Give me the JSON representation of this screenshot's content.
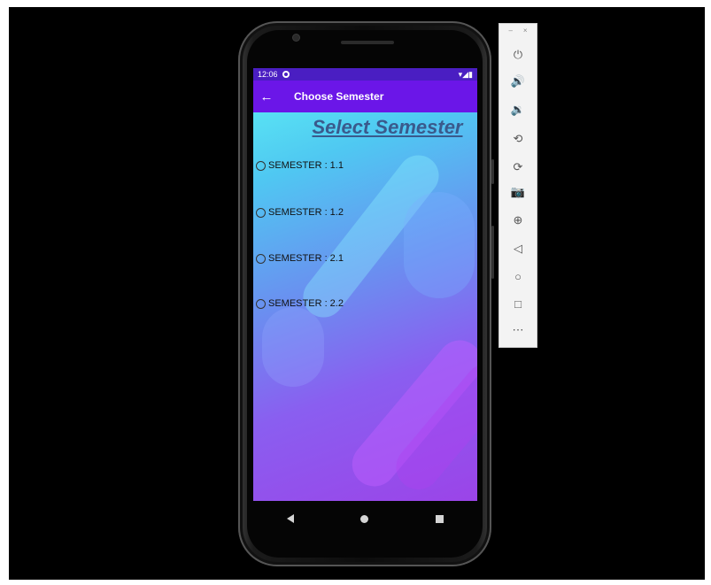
{
  "status_bar": {
    "time": "12:06",
    "signal_icons": "▾◢▮"
  },
  "app_bar": {
    "back_icon": "←",
    "title": "Choose Semester"
  },
  "heading": "Select Semester",
  "options": [
    {
      "label": "SEMESTER : 1.1",
      "selected": false
    },
    {
      "label": "SEMESTER : 1.2",
      "selected": false
    },
    {
      "label": "SEMESTER : 2.1",
      "selected": false
    },
    {
      "label": "SEMESTER : 2.2",
      "selected": false
    }
  ],
  "emulator_toolbar": {
    "minimize": "–",
    "close": "×",
    "buttons": [
      {
        "name": "power-icon",
        "glyph": "⏻"
      },
      {
        "name": "volume-up-icon",
        "glyph": "🔊"
      },
      {
        "name": "volume-down-icon",
        "glyph": "🔉"
      },
      {
        "name": "rotate-left-icon",
        "glyph": "⟲"
      },
      {
        "name": "rotate-right-icon",
        "glyph": "⟳"
      },
      {
        "name": "camera-icon",
        "glyph": "📷"
      },
      {
        "name": "zoom-icon",
        "glyph": "⊕"
      },
      {
        "name": "back-icon",
        "glyph": "◁"
      },
      {
        "name": "home-icon",
        "glyph": "○"
      },
      {
        "name": "overview-icon",
        "glyph": "□"
      },
      {
        "name": "more-icon",
        "glyph": "⋯"
      }
    ]
  },
  "colors": {
    "app_bar": "#6b16e8",
    "status_bar": "#4a1ec2",
    "heading": "#3a5a8c"
  }
}
